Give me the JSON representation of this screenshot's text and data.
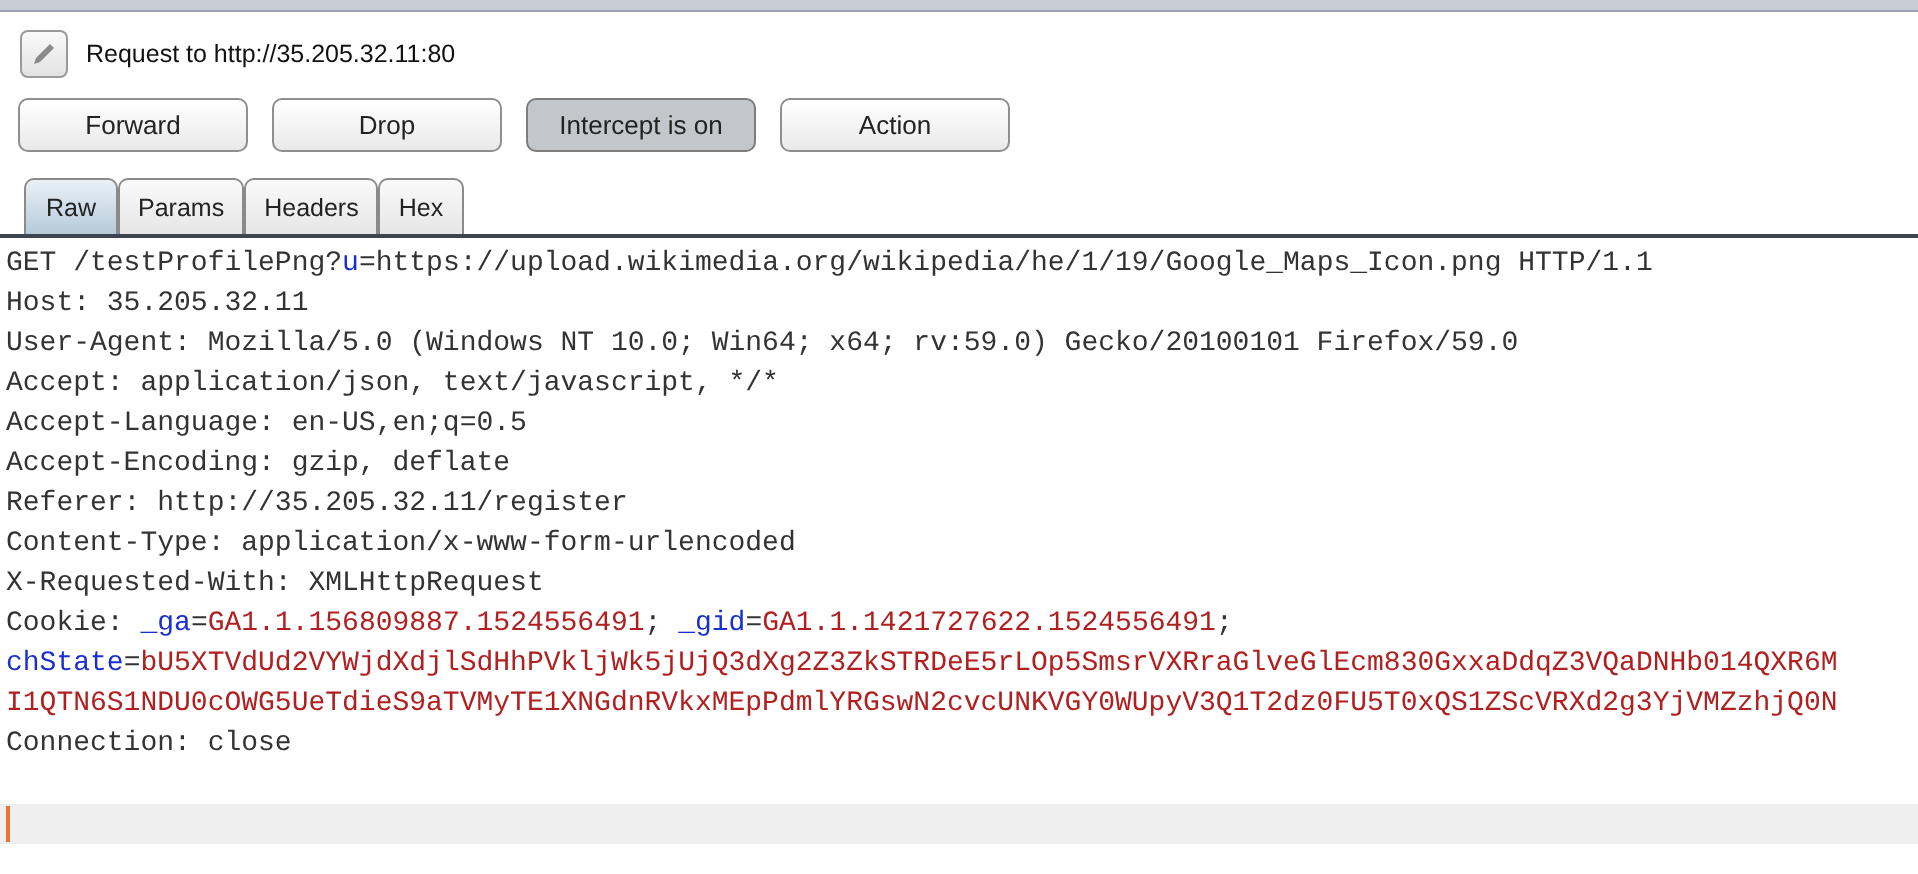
{
  "header": {
    "title": "Request to http://35.205.32.11:80"
  },
  "buttons": [
    {
      "label": "Forward",
      "pressed": false
    },
    {
      "label": "Drop",
      "pressed": false
    },
    {
      "label": "Intercept is on",
      "pressed": true
    },
    {
      "label": "Action",
      "pressed": false
    }
  ],
  "tabs": [
    {
      "label": "Raw",
      "selected": true
    },
    {
      "label": "Params",
      "selected": false
    },
    {
      "label": "Headers",
      "selected": false
    },
    {
      "label": "Hex",
      "selected": false
    }
  ],
  "editor": {
    "lines": [
      {
        "current": false,
        "segments": [
          {
            "kind": "plain",
            "text": "GET /testProfilePng?"
          },
          {
            "kind": "name",
            "text": "u"
          },
          {
            "kind": "plain",
            "text": "=https://upload.wikimedia.org/wikipedia/he/1/19/Google_Maps_Icon.png HTTP/1.1"
          }
        ]
      },
      {
        "current": false,
        "segments": [
          {
            "kind": "plain",
            "text": "Host: 35.205.32.11"
          }
        ]
      },
      {
        "current": false,
        "segments": [
          {
            "kind": "plain",
            "text": "User-Agent: Mozilla/5.0 (Windows NT 10.0; Win64; x64; rv:59.0) Gecko/20100101 Firefox/59.0"
          }
        ]
      },
      {
        "current": false,
        "segments": [
          {
            "kind": "plain",
            "text": "Accept: application/json, text/javascript, */*"
          }
        ]
      },
      {
        "current": false,
        "segments": [
          {
            "kind": "plain",
            "text": "Accept-Language: en-US,en;q=0.5"
          }
        ]
      },
      {
        "current": false,
        "segments": [
          {
            "kind": "plain",
            "text": "Accept-Encoding: gzip, deflate"
          }
        ]
      },
      {
        "current": false,
        "segments": [
          {
            "kind": "plain",
            "text": "Referer: http://35.205.32.11/register"
          }
        ]
      },
      {
        "current": false,
        "segments": [
          {
            "kind": "plain",
            "text": "Content-Type: application/x-www-form-urlencoded"
          }
        ]
      },
      {
        "current": false,
        "segments": [
          {
            "kind": "plain",
            "text": "X-Requested-With: XMLHttpRequest"
          }
        ]
      },
      {
        "current": false,
        "segments": [
          {
            "kind": "plain",
            "text": "Cookie: "
          },
          {
            "kind": "name",
            "text": "_ga"
          },
          {
            "kind": "plain",
            "text": "="
          },
          {
            "kind": "value",
            "text": "GA1.1.156809887.1524556491"
          },
          {
            "kind": "plain",
            "text": "; "
          },
          {
            "kind": "name",
            "text": "_gid"
          },
          {
            "kind": "plain",
            "text": "="
          },
          {
            "kind": "value",
            "text": "GA1.1.1421727622.1524556491"
          },
          {
            "kind": "plain",
            "text": ";"
          }
        ]
      },
      {
        "current": false,
        "segments": [
          {
            "kind": "name",
            "text": "chState"
          },
          {
            "kind": "plain",
            "text": "="
          },
          {
            "kind": "value",
            "text": "bU5XTVdUd2VYWjdXdjlSdHhPVkljWk5jUjQ3dXg2Z3ZkSTRDeE5rLOp5SmsrVXRraGlveGlEcm830GxxaDdqZ3VQaDNHb014QXR6M"
          }
        ]
      },
      {
        "current": false,
        "segments": [
          {
            "kind": "value",
            "text": "I1QTN6S1NDU0cOWG5UeTdieS9aTVMyTE1XNGdnRVkxMEpPdmlYRGswN2cvcUNKVGY0WUpyV3Q1T2dz0FU5T0xQS1ZScVRXd2g3YjVMZzhjQ0N"
          }
        ]
      },
      {
        "current": false,
        "segments": [
          {
            "kind": "plain",
            "text": "Connection: close"
          }
        ]
      },
      {
        "current": true
      }
    ]
  }
}
